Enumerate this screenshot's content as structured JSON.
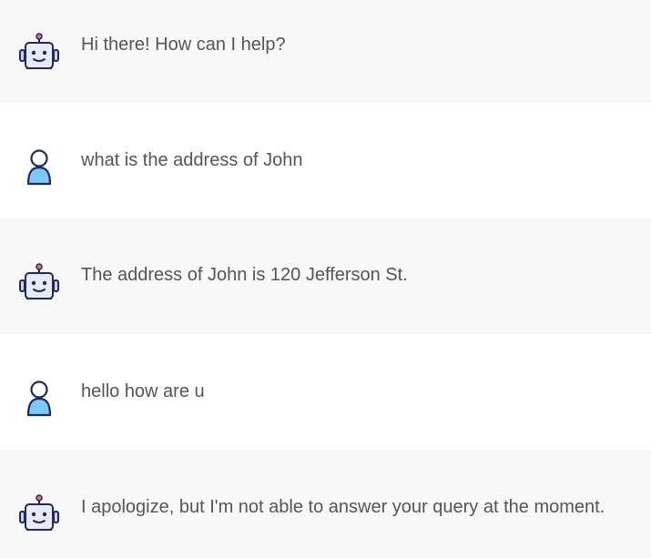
{
  "messages": [
    {
      "role": "bot",
      "avatar_icon": "robot-icon",
      "text": "Hi there! How can I help?"
    },
    {
      "role": "user",
      "avatar_icon": "user-icon",
      "text": "what is the address of John"
    },
    {
      "role": "bot",
      "avatar_icon": "robot-icon",
      "text": "The address of John is 120 Jefferson St."
    },
    {
      "role": "user",
      "avatar_icon": "user-icon",
      "text": "hello how are u"
    },
    {
      "role": "bot",
      "avatar_icon": "robot-icon",
      "text": "I apologize, but I'm not able to answer your query at the moment."
    }
  ],
  "colors": {
    "bot_row_bg": "#f8f8f8",
    "user_row_bg": "#ffffff",
    "text": "#555555",
    "icon_outline": "#1f2a5a",
    "robot_face": "#e6ebf7",
    "robot_antenna_tip": "#f06a8a",
    "user_fill": "#7cc9f5"
  }
}
